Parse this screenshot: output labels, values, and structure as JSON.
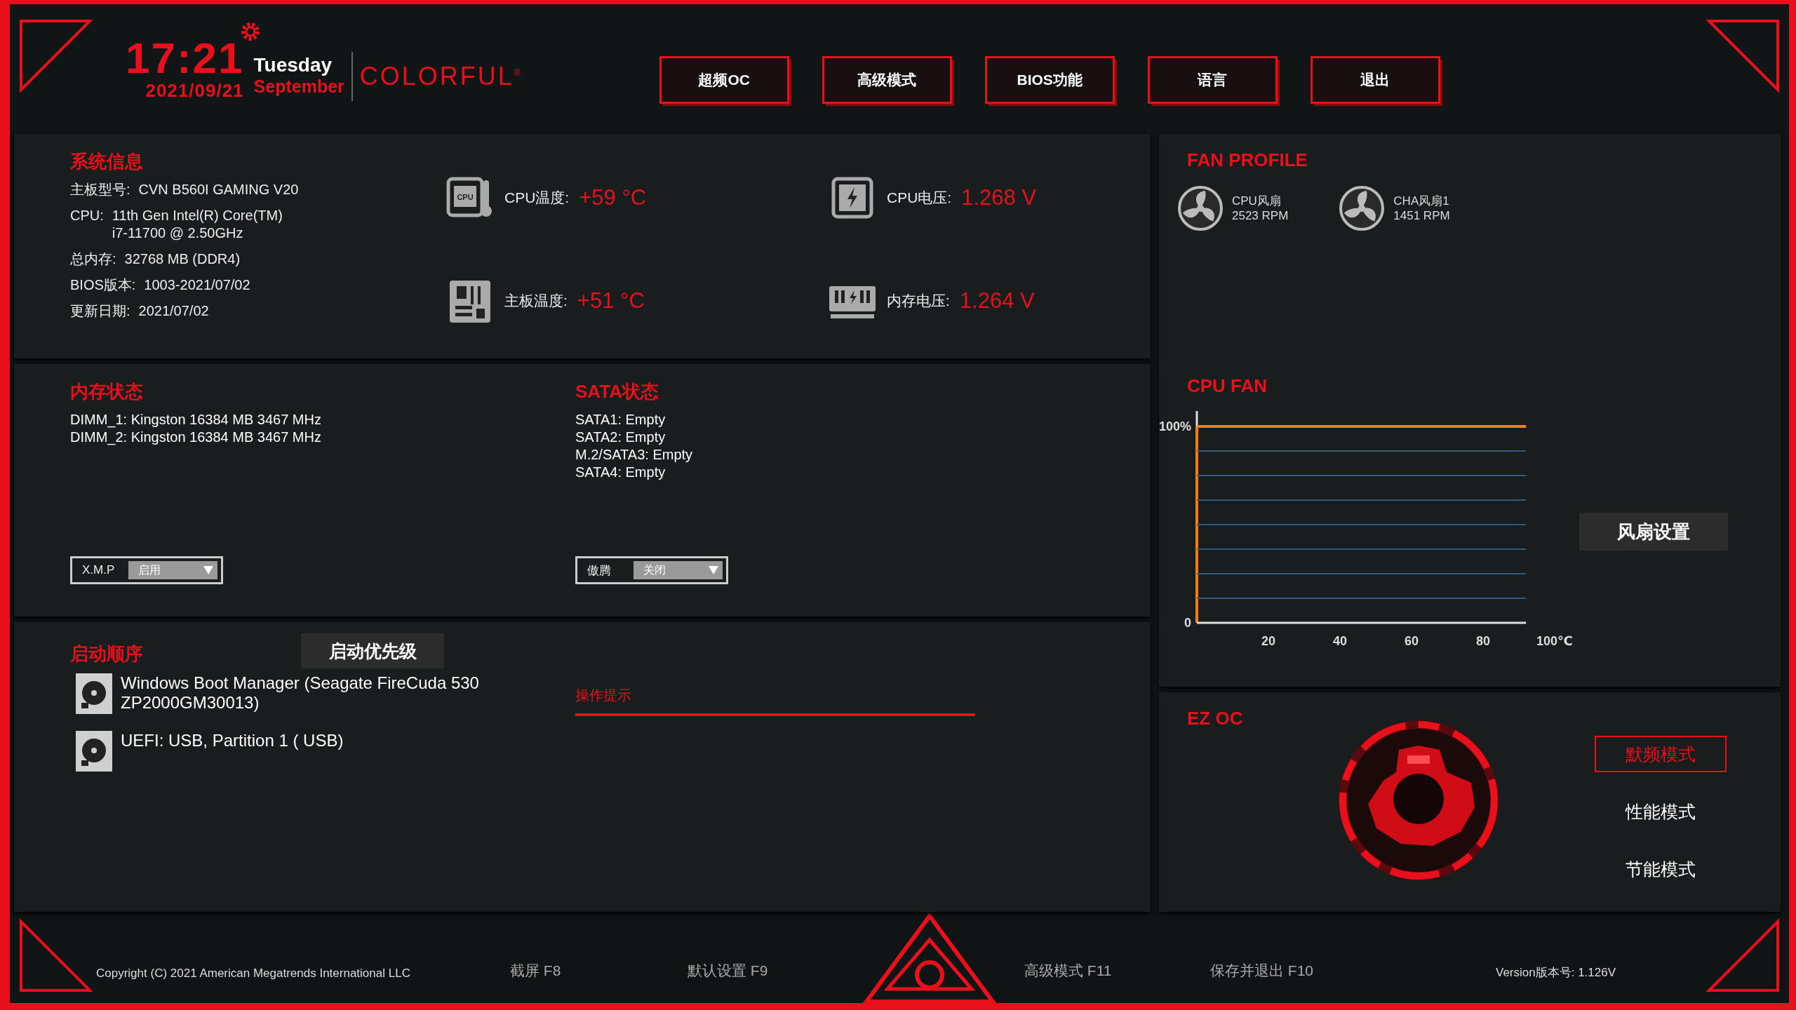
{
  "header": {
    "time": "17:21",
    "date": "2021/09/21",
    "weekday": "Tuesday",
    "month": "September",
    "brand": "COLORFUL$^{®}$"
  },
  "nav": [
    "超频OC",
    "高级模式",
    "BIOS功能",
    "语言",
    "退出"
  ],
  "system_info": {
    "title": "系统信息",
    "rows": [
      {
        "label": "主板型号:",
        "lines": [
          "CVN B560I GAMING V20"
        ]
      },
      {
        "label": "CPU:",
        "lines": [
          "11th Gen Intel(R) Core(TM)",
          "i7-11700 @ 2.50GHz"
        ]
      },
      {
        "label": "总内存:",
        "lines": [
          "32768 MB (DDR4)"
        ]
      },
      {
        "label": "BIOS版本:",
        "lines": [
          "1003-2021/07/02"
        ]
      },
      {
        "label": "更新日期:",
        "lines": [
          "2021/07/02"
        ]
      }
    ]
  },
  "sensors": [
    {
      "kind": "cpu",
      "icon_text": "CPU",
      "label": "CPU温度:",
      "value": "+59 °C"
    },
    {
      "kind": "voltage",
      "label": "CPU电压:",
      "value": "1.268 V"
    },
    {
      "kind": "board",
      "label": "主板温度:",
      "value": "+51 °C"
    },
    {
      "kind": "memory",
      "label": "内存电压:",
      "value": "1.264 V"
    }
  ],
  "memory": {
    "title": "内存状态",
    "lines": [
      "DIMM_1: Kingston 16384 MB 3467 MHz",
      "DIMM_2: Kingston 16384 MB 3467 MHz"
    ],
    "select": {
      "label": "X.M.P",
      "value": "启用"
    }
  },
  "sata": {
    "title": "SATA状态",
    "lines": [
      "SATA1: Empty",
      "SATA2: Empty",
      "M.2/SATA3: Empty",
      "SATA4: Empty"
    ],
    "select": {
      "label": "傲腾",
      "value": "关闭"
    }
  },
  "boot": {
    "title": "启动顺序",
    "priority_button": "启动优先级",
    "devices": [
      {
        "lines": [
          "Windows Boot Manager (Seagate FireCuda 530",
          "ZP2000GM30013)"
        ]
      },
      {
        "lines": [
          "UEFI:  USB, Partition 1 ( USB)"
        ]
      }
    ],
    "hint": "操作提示"
  },
  "fan_profile": {
    "title": "FAN PROFILE",
    "fans": [
      {
        "name": "CPU风扇",
        "rpm": "2523 RPM"
      },
      {
        "name": "CHA风扇1",
        "rpm": "1451 RPM"
      }
    ]
  },
  "cpu_fan": {
    "settings_button": "风扇设置",
    "chart_data": {
      "type": "line",
      "title": "CPU FAN",
      "x": [
        0,
        92
      ],
      "series": [
        {
          "color": "#f07f14",
          "values": [
            100,
            100
          ]
        }
      ],
      "ref_lines": [
        {
          "axis": "x",
          "value": 0,
          "color": "#f07f14"
        },
        {
          "axis": "y",
          "value": 12.5,
          "color": "#2f5a80"
        },
        {
          "axis": "y",
          "value": 25,
          "color": "#2f5a80"
        },
        {
          "axis": "y",
          "value": 37.5,
          "color": "#2f5a80"
        },
        {
          "axis": "y",
          "value": 50,
          "color": "#2f5a80"
        },
        {
          "axis": "y",
          "value": 62.5,
          "color": "#2f5a80"
        },
        {
          "axis": "y",
          "value": 75,
          "color": "#2f5a80"
        },
        {
          "axis": "y",
          "value": 87.5,
          "color": "#2f5a80"
        }
      ],
      "xlim": [
        0,
        100
      ],
      "ylim": [
        0,
        100
      ],
      "xticks": [
        20,
        40,
        60,
        80,
        {
          "value": 100,
          "label": "100℃"
        }
      ],
      "yticks": [
        {
          "value": 0,
          "label": "0"
        },
        {
          "value": 100,
          "label": "100%"
        }
      ]
    }
  },
  "ez_oc": {
    "title": "EZ OC",
    "modes": [
      {
        "label": "默频模式",
        "selected": true
      },
      {
        "label": "性能模式",
        "selected": false
      },
      {
        "label": "节能模式",
        "selected": false
      }
    ]
  },
  "footer": {
    "copyright": "Copyright (C) 2021 American Megatrends International LLC",
    "keys": [
      "截屏 F8",
      "默认设置 F9",
      "高级模式 F11",
      "保存并退出 F10"
    ],
    "version": "Version版本号: 1.126V"
  }
}
